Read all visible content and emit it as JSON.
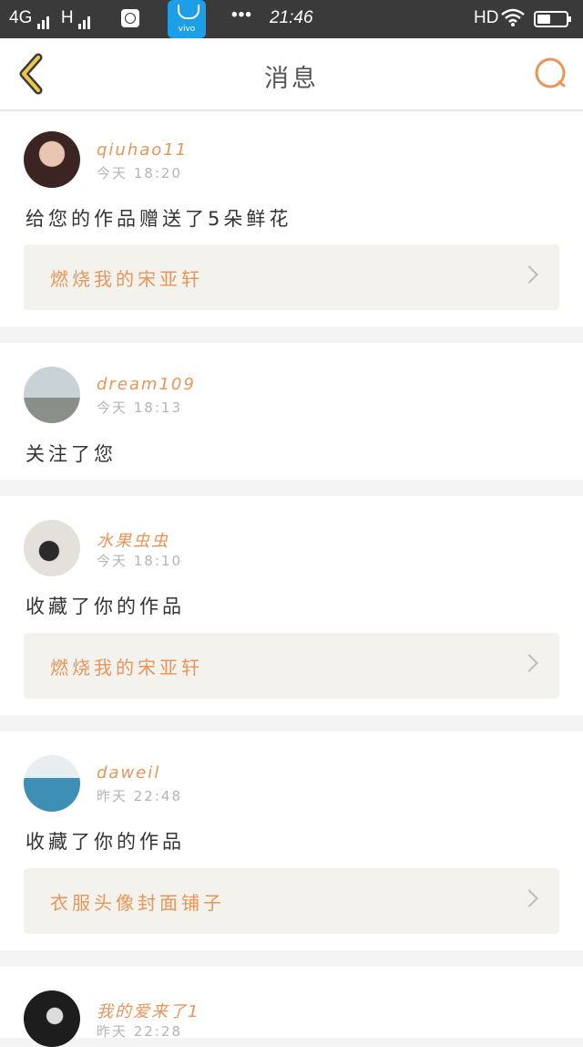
{
  "status_bar": {
    "network": "4G",
    "network2": "H",
    "dots": "•••",
    "time": "21:46",
    "hd": "HD",
    "store_label": "vivo",
    "battery_level": 0.45
  },
  "nav": {
    "title": "消息",
    "back_icon": "chevron-left-icon",
    "search_icon": "search-icon",
    "accent": "#e8955a"
  },
  "messages": [
    {
      "user": "qiuhao11",
      "time": "今天  18:20",
      "text": "给您的作品赠送了5朵鲜花",
      "work": "燃烧我的宋亚轩"
    },
    {
      "user": "dream109",
      "time": "今天  18:13",
      "text": "关注了您",
      "work": null
    },
    {
      "user": "水果虫虫",
      "time": "今天  18:10",
      "text": "收藏了你的作品",
      "work": "燃烧我的宋亚轩"
    },
    {
      "user": "daweil",
      "time": "昨天  22:48",
      "text": "收藏了你的作品",
      "work": "衣服头像封面铺子"
    },
    {
      "user": "我的爱来了1",
      "time": "昨天  22:28",
      "text": "",
      "work": null
    }
  ]
}
